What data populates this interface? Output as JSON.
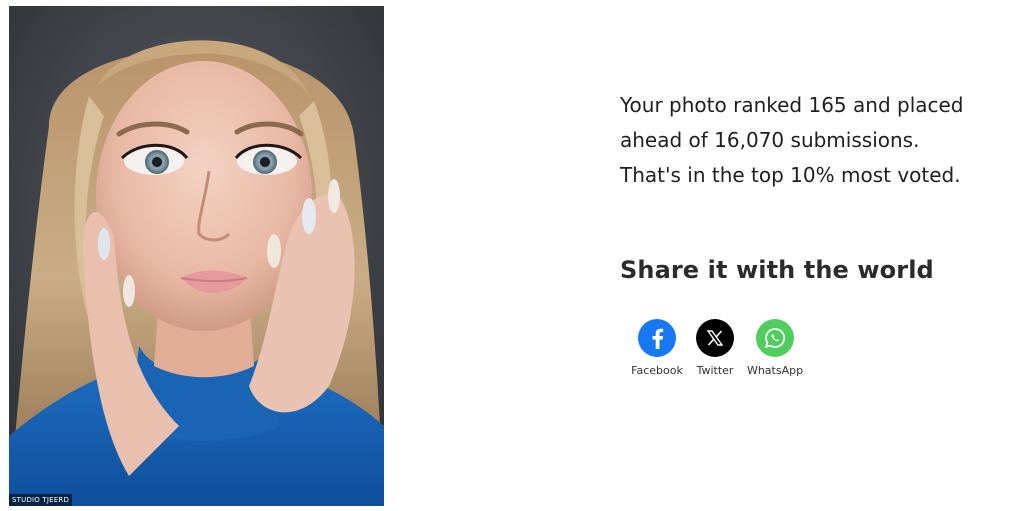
{
  "photo": {
    "watermark": "STUDIO TJEERD"
  },
  "result": {
    "line1": "Your photo ranked 165 and placed",
    "line2": "ahead of 16,070 submissions.",
    "line3": "That's in the top 10% most voted."
  },
  "share": {
    "title": "Share it with the world",
    "buttons": [
      {
        "label": "Facebook",
        "icon": "facebook-icon",
        "color": "#1877f2"
      },
      {
        "label": "Twitter",
        "icon": "x-twitter-icon",
        "color": "#000000"
      },
      {
        "label": "WhatsApp",
        "icon": "whatsapp-icon",
        "color": "#4fce5d"
      }
    ]
  }
}
